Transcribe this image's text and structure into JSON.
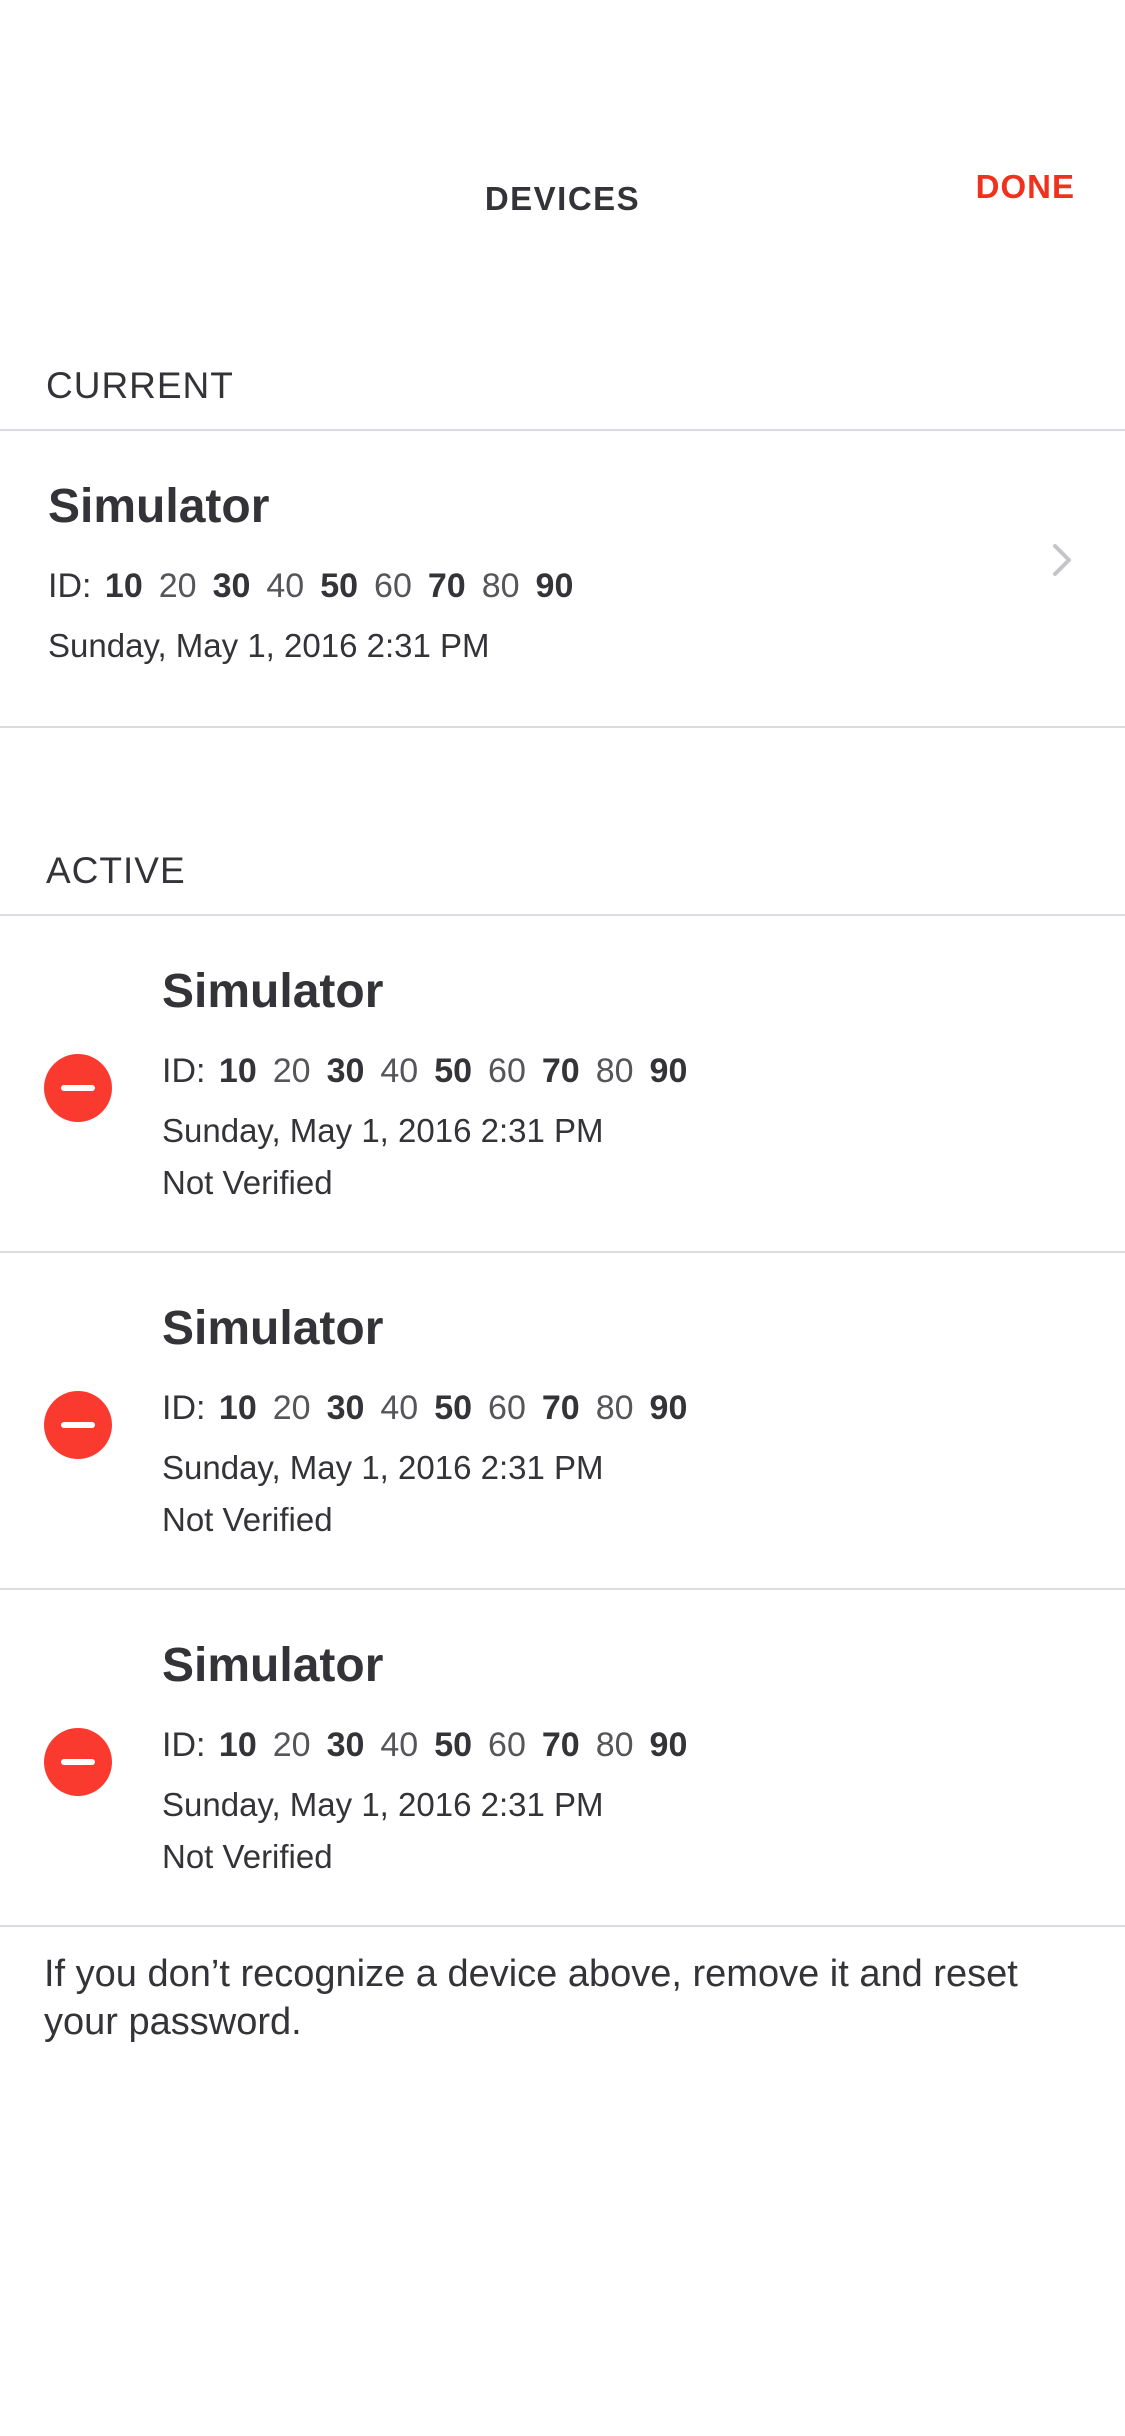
{
  "nav": {
    "title": "DEVICES",
    "done_label": "DONE"
  },
  "current": {
    "header": "CURRENT",
    "device": {
      "name": "Simulator",
      "id_prefix": "ID:",
      "id_segments": [
        "10",
        "20",
        "30",
        "40",
        "50",
        "60",
        "70",
        "80",
        "90"
      ],
      "date": "Sunday, May 1, 2016 2:31 PM",
      "chevron_icon": "chevron-right-icon"
    }
  },
  "active": {
    "header": "ACTIVE",
    "devices": [
      {
        "name": "Simulator",
        "id_prefix": "ID:",
        "id_segments": [
          "10",
          "20",
          "30",
          "40",
          "50",
          "60",
          "70",
          "80",
          "90"
        ],
        "date": "Sunday, May 1, 2016 2:31 PM",
        "status": "Not Verified"
      },
      {
        "name": "Simulator",
        "id_prefix": "ID:",
        "id_segments": [
          "10",
          "20",
          "30",
          "40",
          "50",
          "60",
          "70",
          "80",
          "90"
        ],
        "date": "Sunday, May 1, 2016 2:31 PM",
        "status": "Not Verified"
      },
      {
        "name": "Simulator",
        "id_prefix": "ID:",
        "id_segments": [
          "10",
          "20",
          "30",
          "40",
          "50",
          "60",
          "70",
          "80",
          "90"
        ],
        "date": "Sunday, May 1, 2016 2:31 PM",
        "status": "Not Verified"
      }
    ]
  },
  "footer": {
    "note": "If you don’t recognize a device above, remove it and reset your password."
  },
  "colors": {
    "accent": "#f0311d",
    "remove": "#fb3a2f",
    "text": "#333338",
    "divider": "#dcdce0"
  }
}
